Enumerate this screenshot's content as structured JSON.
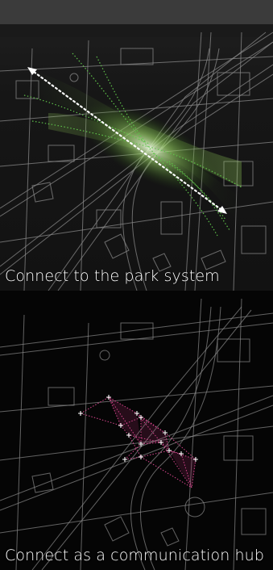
{
  "panels": [
    {
      "caption": "Connect to the park system",
      "overlay": "green-green-corridor-with-white-dotted-double-arrow",
      "accent_color": "#8bd24a",
      "arrow_color": "#ffffff"
    },
    {
      "caption": "Connect as a communication hub",
      "overlay": "magenta-dotted-node-network",
      "accent_color": "#d8468f",
      "node_color": "#ffffff"
    }
  ],
  "colors": {
    "map_lines": "#8a8a8a",
    "background": "#000000",
    "caption_text": "#ffffff"
  }
}
